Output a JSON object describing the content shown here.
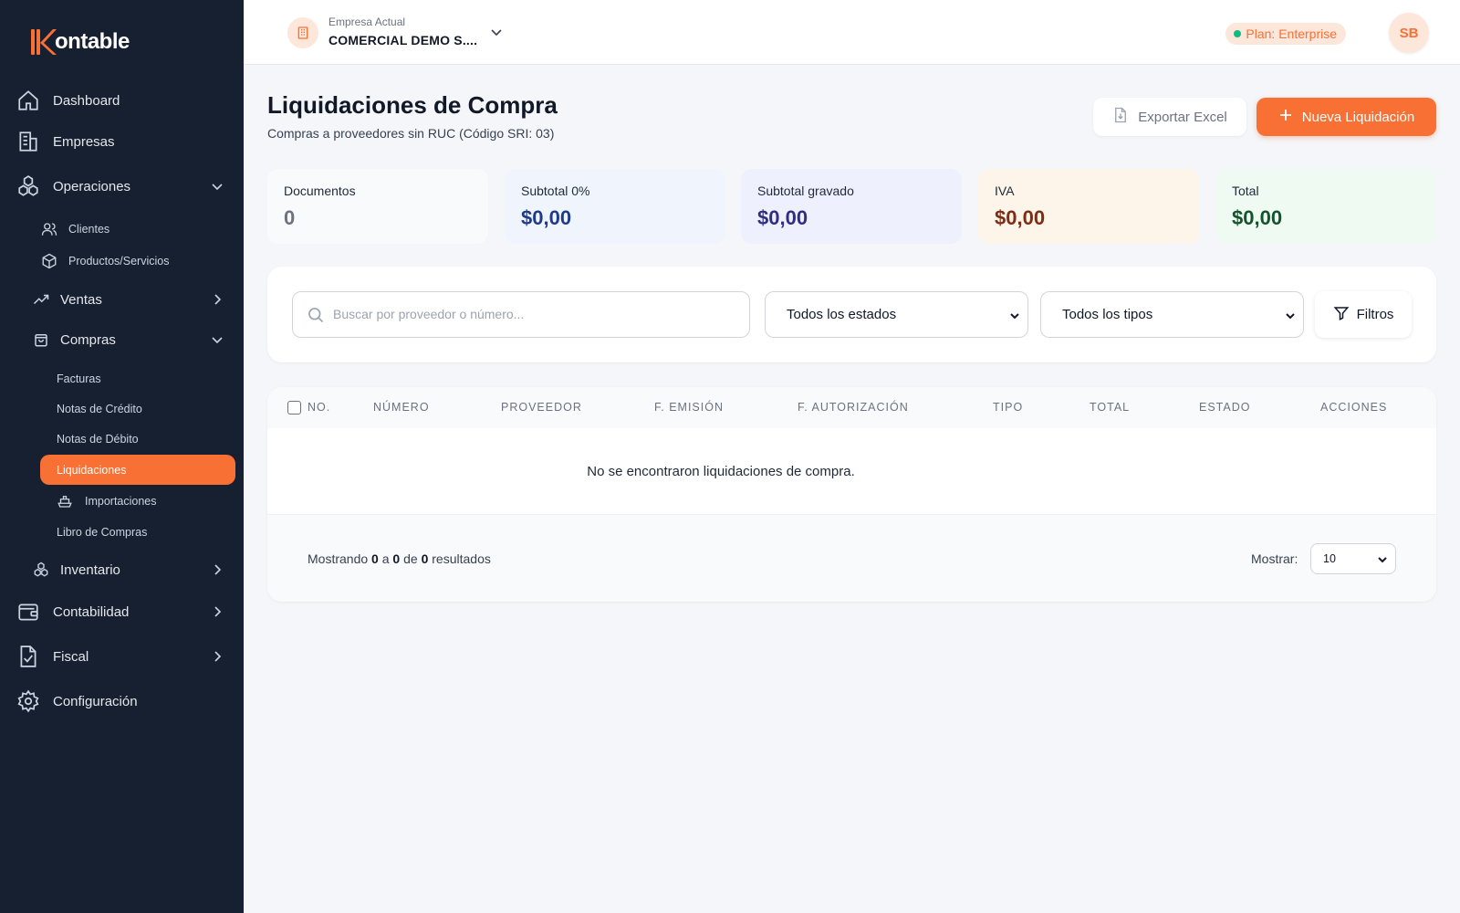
{
  "brand": {
    "logo_text": "ontable",
    "accent": "#f97035",
    "sidebar_bg": "#172030"
  },
  "sidebar": {
    "dashboard": "Dashboard",
    "empresas": "Empresas",
    "operaciones": "Operaciones",
    "clientes": "Clientes",
    "productos": "Productos/Servicios",
    "ventas": "Ventas",
    "compras": "Compras",
    "facturas": "Facturas",
    "notas_credito": "Notas de Crédito",
    "notas_debito": "Notas de Débito",
    "liquidaciones": "Liquidaciones",
    "importaciones": "Importaciones",
    "libro_compras": "Libro de Compras",
    "inventario": "Inventario",
    "contabilidad": "Contabilidad",
    "fiscal": "Fiscal",
    "configuracion": "Configuración"
  },
  "header": {
    "company_label": "Empresa Actual",
    "company_name": "COMERCIAL DEMO S....",
    "plan": "Plan: Enterprise",
    "avatar_initials": "SB"
  },
  "page": {
    "title": "Liquidaciones de Compra",
    "subtitle": "Compras a proveedores sin RUC (Código SRI: 03)",
    "export_label": "Exportar Excel",
    "new_label": "Nueva Liquidación"
  },
  "stats": [
    {
      "label": "Documentos",
      "value": "0",
      "bg": "#f8fafc",
      "color": "#6b7280"
    },
    {
      "label": "Subtotal 0%",
      "value": "$0,00",
      "bg": "#eff4fd",
      "color": "#1e3a8a"
    },
    {
      "label": "Subtotal gravado",
      "value": "$0,00",
      "bg": "#eef1fd",
      "color": "#312e81"
    },
    {
      "label": "IVA",
      "value": "$0,00",
      "bg": "#fdf5ea",
      "color": "#7c2d12"
    },
    {
      "label": "Total",
      "value": "$0,00",
      "bg": "#eefaf2",
      "color": "#14532d"
    }
  ],
  "filters": {
    "search_placeholder": "Buscar por proveedor o número...",
    "estado": "Todos los estados",
    "tipo": "Todos los tipos",
    "filtros_label": "Filtros"
  },
  "table": {
    "columns": [
      "NO.",
      "NÚMERO",
      "PROVEEDOR",
      "F. EMISIÓN",
      "F. AUTORIZACIÓN",
      "TIPO",
      "TOTAL",
      "ESTADO",
      "ACCIONES"
    ],
    "empty_message": "No se encontraron liquidaciones de compra.",
    "footer": {
      "prefix": "Mostrando",
      "from": "0",
      "a": "a",
      "to": "0",
      "de": "de",
      "total": "0",
      "suffix": "resultados"
    },
    "show_label": "Mostrar:",
    "page_size": "10"
  }
}
